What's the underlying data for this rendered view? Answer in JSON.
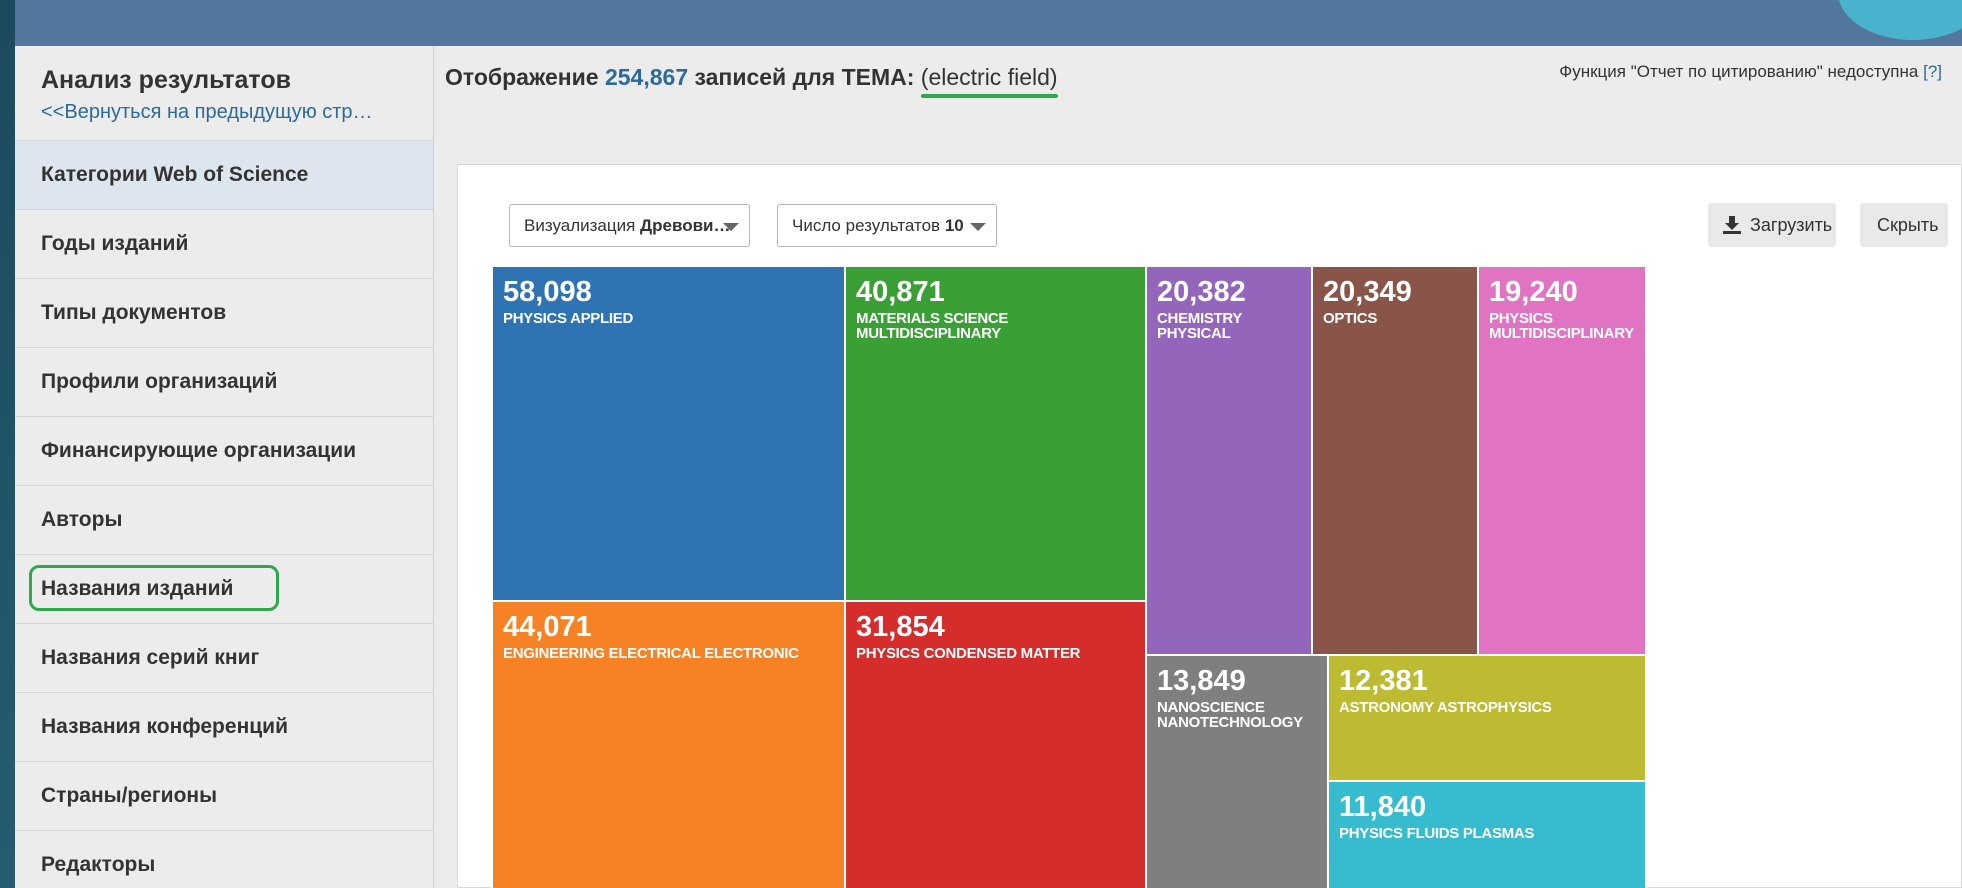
{
  "sidebar": {
    "title": "Анализ результатов",
    "back_link": "<<Вернуться на предыдущую стр…",
    "items": [
      {
        "label": "Категории Web of Science",
        "active": true
      },
      {
        "label": "Годы изданий"
      },
      {
        "label": "Типы документов"
      },
      {
        "label": "Профили организаций"
      },
      {
        "label": "Финансирующие организации"
      },
      {
        "label": "Авторы"
      },
      {
        "label": "Названия изданий",
        "highlighted": true
      },
      {
        "label": "Названия серий книг"
      },
      {
        "label": "Названия конференций"
      },
      {
        "label": "Страны/регионы"
      },
      {
        "label": "Редакторы"
      }
    ]
  },
  "header": {
    "prefix": "Отображение",
    "count": "254,867",
    "middle": "записей для ТЕМА:",
    "query": "(electric field)",
    "citation_note": "Функция \"Отчет по цитированию\" недоступна",
    "help": "[?]"
  },
  "controls": {
    "visualization_prefix": "Визуализация",
    "visualization_value": "Древови…",
    "results_prefix": "Число результатов",
    "results_value": "10",
    "download_label": "Загрузить",
    "hide_label": "Скрыть"
  },
  "treemap": {
    "tiles": [
      {
        "value": "58,098",
        "name": "PHYSICS APPLIED",
        "color": "#2f74b2"
      },
      {
        "value": "40,871",
        "name": "MATERIALS SCIENCE MULTIDISCIPLINARY",
        "color": "#3aa035"
      },
      {
        "value": "44,071",
        "name": "ENGINEERING ELECTRICAL ELECTRONIC",
        "color": "#f78225"
      },
      {
        "value": "31,854",
        "name": "PHYSICS CONDENSED MATTER",
        "color": "#d42d2b"
      },
      {
        "value": "20,382",
        "name": "CHEMISTRY PHYSICAL",
        "color": "#9366bb"
      },
      {
        "value": "20,349",
        "name": "OPTICS",
        "color": "#8a5549"
      },
      {
        "value": "19,240",
        "name": "PHYSICS MULTIDISCIPLINARY",
        "color": "#e074c3"
      },
      {
        "value": "13,849",
        "name": "NANOSCIENCE NANOTECHNOLOGY",
        "color": "#7f7f7f"
      },
      {
        "value": "12,381",
        "name": "ASTRONOMY ASTROPHYSICS",
        "color": "#bcbb32"
      },
      {
        "value": "11,840",
        "name": "PHYSICS FLUIDS PLASMAS",
        "color": "#37bbce"
      }
    ]
  }
}
